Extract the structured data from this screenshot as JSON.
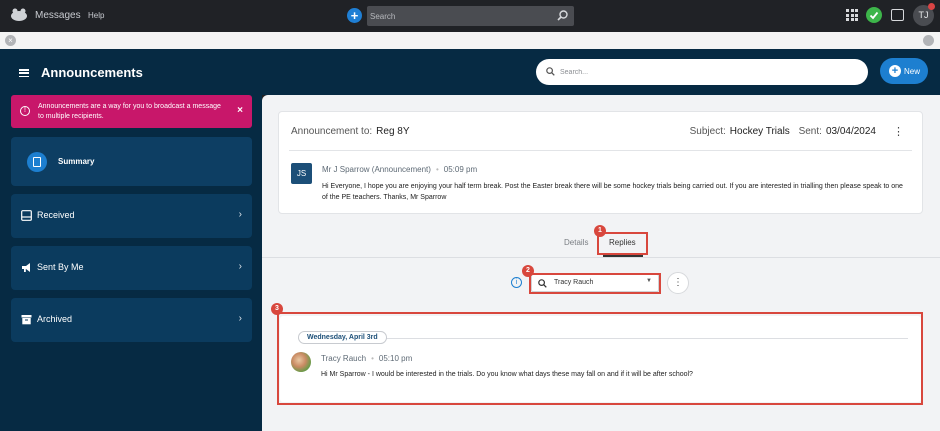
{
  "topbar": {
    "app_name": "Messages",
    "help": "Help",
    "search_placeholder": "Search",
    "user_initials": "TJ"
  },
  "header": {
    "title": "Announcements",
    "search_placeholder": "Search...",
    "new_label": "New"
  },
  "sidebar": {
    "alert": "Announcements are a way for you to broadcast a message to multiple recipients.",
    "items": [
      {
        "label": "Summary"
      },
      {
        "label": "Received"
      },
      {
        "label": "Sent By Me"
      },
      {
        "label": "Archived"
      }
    ]
  },
  "announcement": {
    "to_label": "Announcement to:",
    "to_value": "Reg 8Y",
    "subject_label": "Subject:",
    "subject_value": "Hockey Trials",
    "sent_label": "Sent:",
    "sent_value": "03/04/2024",
    "author_initials": "JS",
    "author": "Mr J Sparrow (Announcement)",
    "time": "05:09 pm",
    "message": "Hi Everyone, I hope you are enjoying your half term break. Post the Easter break there will be some hockey trials being carried out. If you are interested in trialling then please speak to one of the PE teachers. Thanks, Mr Sparrow"
  },
  "tabs": [
    {
      "label": "Details"
    },
    {
      "label": "Replies"
    }
  ],
  "filter": {
    "selected": "Tracy Rauch"
  },
  "reply": {
    "date": "Wednesday, April 3rd",
    "author": "Tracy Rauch",
    "time": "05:10 pm",
    "message": "Hi Mr Sparrow - I would be interested in the trials. Do you know what days these may fall on and if it will be after school?"
  },
  "callouts": [
    "1",
    "2",
    "3"
  ],
  "colors": {
    "header": "#062a43",
    "accent": "#1d7fd0",
    "alert": "#c8176a",
    "callout": "#d8473d"
  }
}
